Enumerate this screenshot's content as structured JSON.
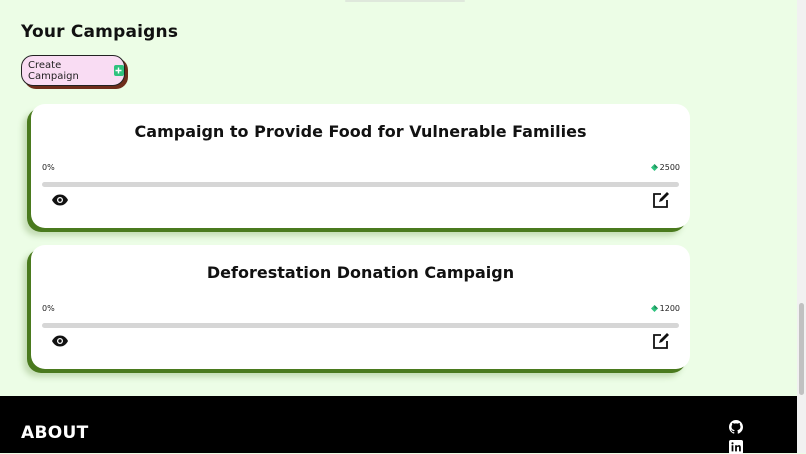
{
  "page": {
    "section_title": "Your Campaigns",
    "create_button": {
      "label": "Create Campaign",
      "icon": "add-square-icon"
    }
  },
  "campaigns": [
    {
      "title": "Campaign to Provide Food for Vulnerable Families",
      "progress_label": "0%",
      "progress_fraction": 0,
      "goal": "2500",
      "goal_icon": "green-gem-icon"
    },
    {
      "title": "Deforestation Donation Campaign",
      "progress_label": "0%",
      "progress_fraction": 0,
      "goal": "1200",
      "goal_icon": "green-gem-icon"
    }
  ],
  "actions": {
    "view_icon": "eye-icon",
    "edit_icon": "edit-icon"
  },
  "footer": {
    "title": "ABOUT",
    "social": [
      "github-icon",
      "linkedin-icon"
    ]
  },
  "colors": {
    "background": "#ecfde6",
    "card_shadow": "#4a7a1e",
    "button_bg": "#f9dcf3",
    "footer_bg": "#000000"
  }
}
